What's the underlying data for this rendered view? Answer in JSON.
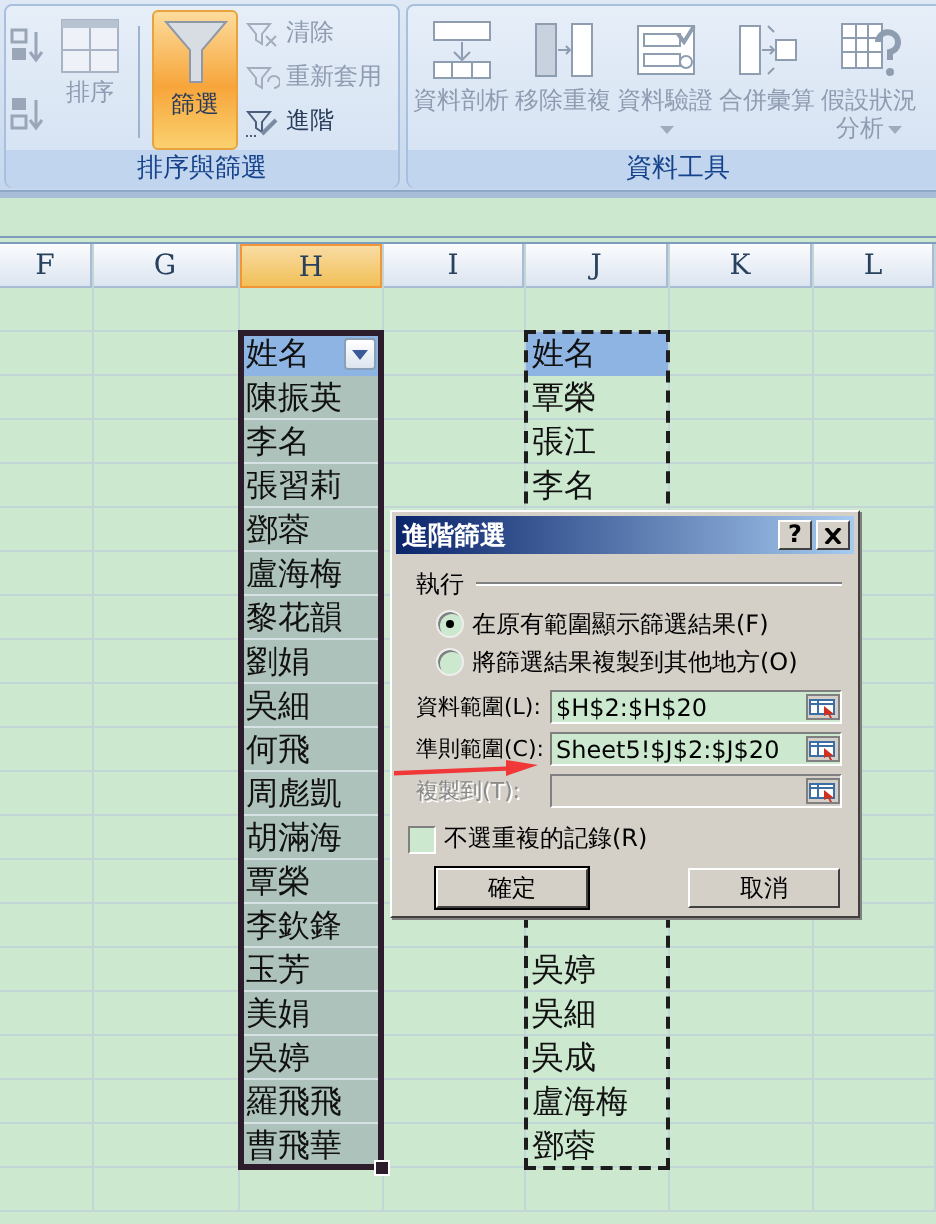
{
  "ribbon": {
    "sort_filter": {
      "label": "排序與篩選",
      "sort": {
        "label": "排序",
        "disabled": true
      },
      "filter": {
        "label": "篩選",
        "selected": true
      },
      "commands": [
        {
          "label": "清除",
          "kind": "clear",
          "disabled": true
        },
        {
          "label": "重新套用",
          "kind": "reapply",
          "disabled": true
        },
        {
          "label": "進階",
          "kind": "advanced",
          "disabled": false
        }
      ]
    },
    "data_tools": {
      "label": "資料工具",
      "buttons": [
        {
          "label": "資料剖析",
          "kind": "split",
          "disabled": true,
          "dropdown": false
        },
        {
          "label": "移除重複",
          "kind": "dedupe",
          "disabled": true,
          "dropdown": false
        },
        {
          "label": "資料驗證",
          "kind": "validate",
          "disabled": true,
          "dropdown": true
        },
        {
          "label": "合併彙算",
          "kind": "consolidate",
          "disabled": true,
          "dropdown": false
        },
        {
          "label": "假設狀況分析",
          "kind": "whatif",
          "disabled": true,
          "dropdown": true
        }
      ]
    }
  },
  "columns": [
    {
      "label": "F",
      "selected": false
    },
    {
      "label": "G",
      "selected": false
    },
    {
      "label": "H",
      "selected": true
    },
    {
      "label": "I",
      "selected": false
    },
    {
      "label": "J",
      "selected": false
    },
    {
      "label": "K",
      "selected": false
    },
    {
      "label": "L",
      "selected": false
    }
  ],
  "list_range": {
    "header": "姓名",
    "rows": [
      "陳振英",
      "李名",
      "張習莉",
      "鄧蓉",
      "盧海梅",
      "黎花韻",
      "劉娟",
      "吳細",
      "何飛",
      "周彪凱",
      "胡滿海",
      "覃榮",
      "李欽鋒",
      "玉芳",
      "美娟",
      "吳婷",
      "羅飛飛",
      "曹飛華"
    ]
  },
  "criteria_range": {
    "header": "姓名",
    "rows_top": [
      "覃榮",
      "張江",
      "李名"
    ],
    "rows_bottom": [
      "吳婷",
      "吳細",
      "吳成",
      "盧海梅",
      "鄧蓉"
    ]
  },
  "dialog": {
    "title": "進階篩選",
    "help_button": "?",
    "section": "執行",
    "options": [
      {
        "label": "在原有範圍顯示篩選結果(F)",
        "selected": true
      },
      {
        "label": "將篩選結果複製到其他地方(O)",
        "selected": false
      }
    ],
    "fields": [
      {
        "label": "資料範圍(L):",
        "value": "$H$2:$H$20",
        "disabled": false
      },
      {
        "label": "準則範圍(C):",
        "value": "Sheet5!$J$2:$J$20",
        "disabled": false
      },
      {
        "label": "複製到(T):",
        "disabled": true
      }
    ],
    "unique_only": {
      "label": "不選重複的記錄(R)",
      "checked": false
    },
    "buttons": [
      {
        "label": "確定",
        "default": true
      },
      {
        "label": "取消",
        "default": false
      }
    ]
  }
}
